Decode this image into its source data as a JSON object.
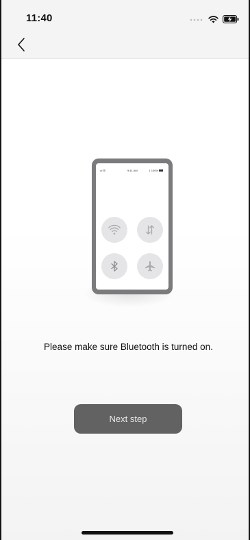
{
  "status_bar": {
    "time": "11:40",
    "icons": [
      "cellular-signal-icon",
      "wifi-icon",
      "battery-charging-icon"
    ]
  },
  "nav": {
    "back_icon": "chevron-left-icon"
  },
  "illustration": {
    "mini_status": {
      "signal": "•ıl ☰",
      "time": "9:41 AM",
      "battery": "1 100%"
    },
    "toggles": [
      "wifi-icon",
      "mobile-data-icon",
      "bluetooth-icon",
      "airplane-icon"
    ]
  },
  "message": "Please make sure Bluetooth is turned on.",
  "next_button": {
    "label": "Next step"
  },
  "colors": {
    "button_bg": "#626262",
    "button_text": "#e9e9e9",
    "phone_frame": "#7b7b7d",
    "toggle_bg": "#e5e5e7"
  }
}
